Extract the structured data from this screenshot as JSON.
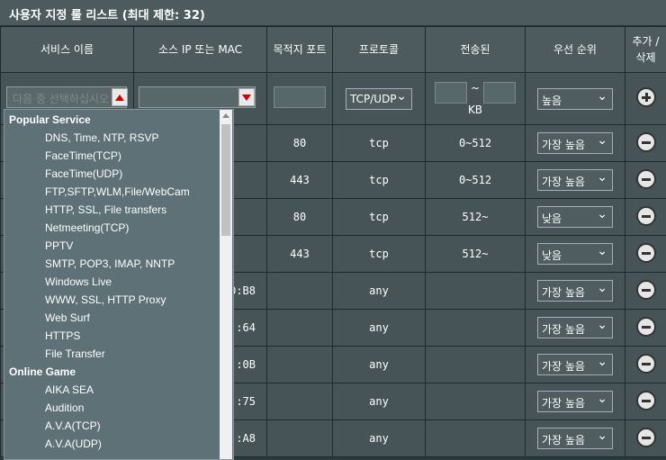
{
  "title": "사용자 지정 룰 리스트 (최대 제한: 32)",
  "headers": {
    "service": "서비스 이름",
    "source": "소스 IP 또는 MAC",
    "port": "목적지 포트",
    "protocol": "프로토콜",
    "transferred": "전송된",
    "priority": "우선 순위",
    "add_delete": "추가 / 삭제"
  },
  "input_row": {
    "service_placeholder": "다음 중 선택하십시오",
    "protocol": "TCP/UDP",
    "transfer_sep": "~",
    "transfer_unit": "KB",
    "priority": "높음"
  },
  "rows": [
    {
      "source": "",
      "port": "80",
      "protocol": "tcp",
      "transferred": "0~512",
      "priority": "가장 높음"
    },
    {
      "source": "",
      "port": "443",
      "protocol": "tcp",
      "transferred": "0~512",
      "priority": "가장 높음"
    },
    {
      "source": "",
      "port": "80",
      "protocol": "tcp",
      "transferred": "512~",
      "priority": "낮음"
    },
    {
      "source": "",
      "port": "443",
      "protocol": "tcp",
      "transferred": "512~",
      "priority": "낮음"
    },
    {
      "source": "0:B8",
      "port": "",
      "protocol": "any",
      "transferred": "",
      "priority": "가장 높음"
    },
    {
      "source": ":64",
      "port": "",
      "protocol": "any",
      "transferred": "",
      "priority": "가장 높음"
    },
    {
      "source": ":0B",
      "port": "",
      "protocol": "any",
      "transferred": "",
      "priority": "가장 높음"
    },
    {
      "source": ":75",
      "port": "",
      "protocol": "any",
      "transferred": "",
      "priority": "가장 높음"
    },
    {
      "source": ":A8",
      "port": "",
      "protocol": "any",
      "transferred": "",
      "priority": "가장 높음"
    }
  ],
  "dropdown": {
    "group1": "Popular Service",
    "popular": [
      "DNS, Time, NTP, RSVP",
      "FaceTime(TCP)",
      "FaceTime(UDP)",
      "FTP,SFTP,WLM,File/WebCam",
      "HTTP, SSL, File transfers",
      "Netmeeting(TCP)",
      "PPTV",
      "SMTP, POP3, IMAP, NNTP",
      "Windows Live",
      "WWW, SSL, HTTP Proxy",
      "Web Surf",
      "HTTPS",
      "File Transfer"
    ],
    "group2": "Online Game",
    "games": [
      "AIKA SEA",
      "Audition",
      "A.V.A(TCP)",
      "A.V.A(UDP)"
    ]
  },
  "colors": {
    "header_bg": "#4d5b5f",
    "row_bg": "#475457",
    "dropdown_bg": "#5e7177"
  }
}
